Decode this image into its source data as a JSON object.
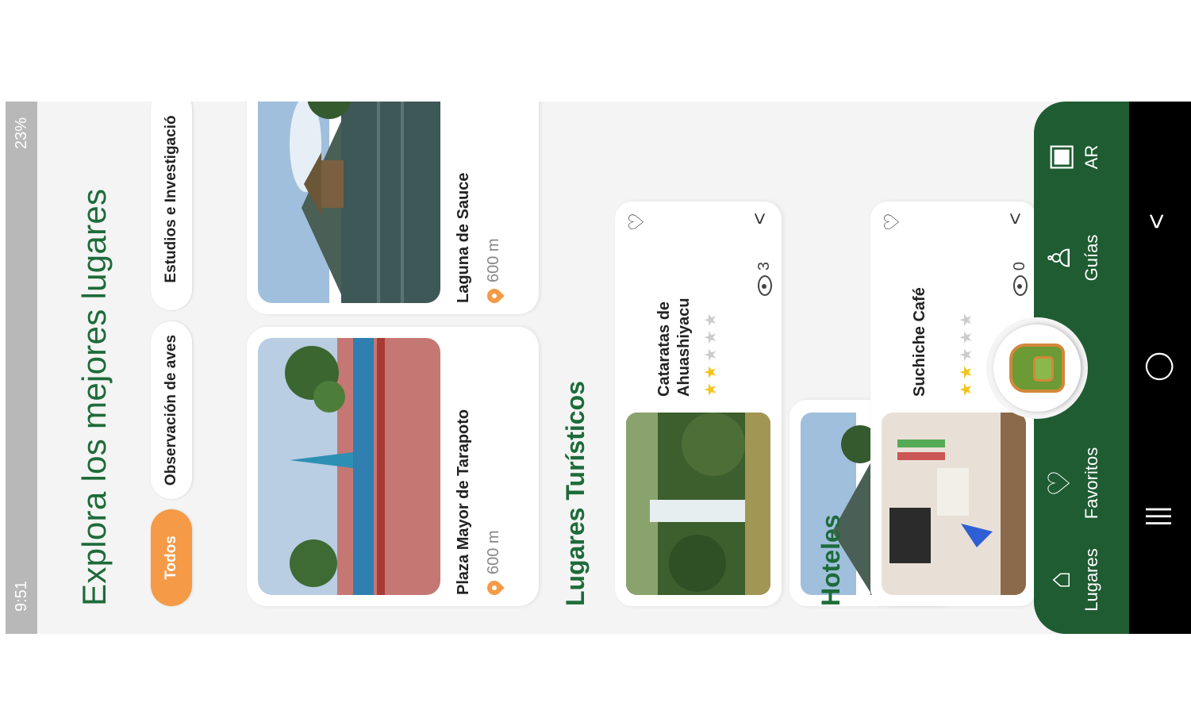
{
  "status_bar": {
    "time": "9:51",
    "right": "23%"
  },
  "header": {
    "title": "Explora los mejores lugares"
  },
  "chips": [
    {
      "label": "Todos",
      "active": true
    },
    {
      "label": "Observación de aves",
      "active": false
    },
    {
      "label": "Estudios e Investigació",
      "active": false
    }
  ],
  "featured": [
    {
      "title": "Plaza Mayor de Tarapoto",
      "distance": "600 m"
    },
    {
      "title": "Laguna de Sauce",
      "distance": "600 m"
    }
  ],
  "sections": {
    "tourist_title": "Lugares Turísticos",
    "hotels_title": "Hoteles"
  },
  "tourist_places": [
    {
      "title": "Cataratas de Ahuashiyacu",
      "rating": 2,
      "views": "3"
    }
  ],
  "hotels": [
    {
      "title": "Suchiche Café",
      "rating": 2,
      "views": "0"
    }
  ],
  "bottom_nav": [
    {
      "label": "Lugares",
      "icon": "map-pin-icon"
    },
    {
      "label": "Favoritos",
      "icon": "heart-icon"
    },
    {
      "label": "Guías",
      "icon": "person-icon"
    },
    {
      "label": "AR",
      "icon": "ar-icon"
    }
  ],
  "colors": {
    "brand_green": "#1f5c32",
    "accent_orange": "#f59a46",
    "title_green": "#1e6b3a"
  }
}
